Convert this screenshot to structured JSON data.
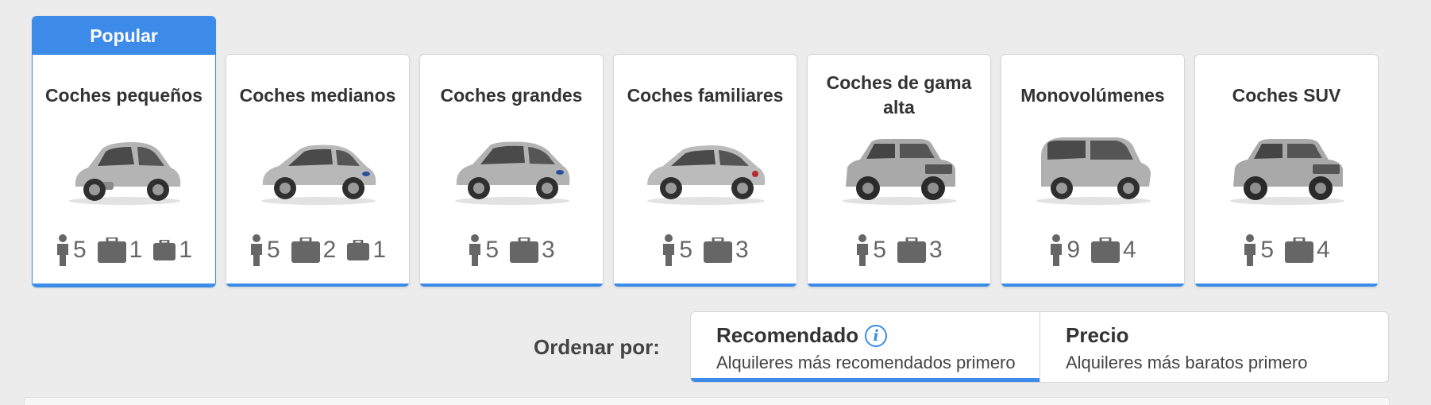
{
  "categories": [
    {
      "title": "Coches pequeños",
      "badge": "Popular",
      "passengers": "5",
      "large_bags": "1",
      "small_bags": "1",
      "car_icon": "small-car-icon",
      "color": "#b4b4b4"
    },
    {
      "title": "Coches medianos",
      "passengers": "5",
      "large_bags": "2",
      "small_bags": "1",
      "car_icon": "hatchback-car-icon",
      "color": "#b8b8b8"
    },
    {
      "title": "Coches grandes",
      "passengers": "5",
      "large_bags": "3",
      "car_icon": "mpv-car-icon",
      "color": "#b2b2b2"
    },
    {
      "title": "Coches familiares",
      "passengers": "5",
      "large_bags": "3",
      "car_icon": "family-car-icon",
      "color": "#bbbbbb"
    },
    {
      "title": "Coches de gama alta",
      "passengers": "5",
      "large_bags": "3",
      "car_icon": "suv-car-icon",
      "color": "#a9a9a9"
    },
    {
      "title": "Monovolúmenes",
      "passengers": "9",
      "large_bags": "4",
      "car_icon": "van-car-icon",
      "color": "#b0b0b0"
    },
    {
      "title": "Coches SUV",
      "passengers": "5",
      "large_bags": "4",
      "car_icon": "suv-car-icon",
      "color": "#a9a9a9"
    }
  ],
  "sort": {
    "label": "Ordenar por:",
    "options": [
      {
        "title": "Recomendado",
        "subtitle": "Alquileres más recomendados primero",
        "active": true,
        "info_icon": "info-icon"
      },
      {
        "title": "Precio",
        "subtitle": "Alquileres más baratos primero",
        "active": false
      }
    ]
  },
  "colors": {
    "accent": "#3d8be8",
    "background": "#ececec",
    "card": "#ffffff",
    "icon": "#666666"
  }
}
